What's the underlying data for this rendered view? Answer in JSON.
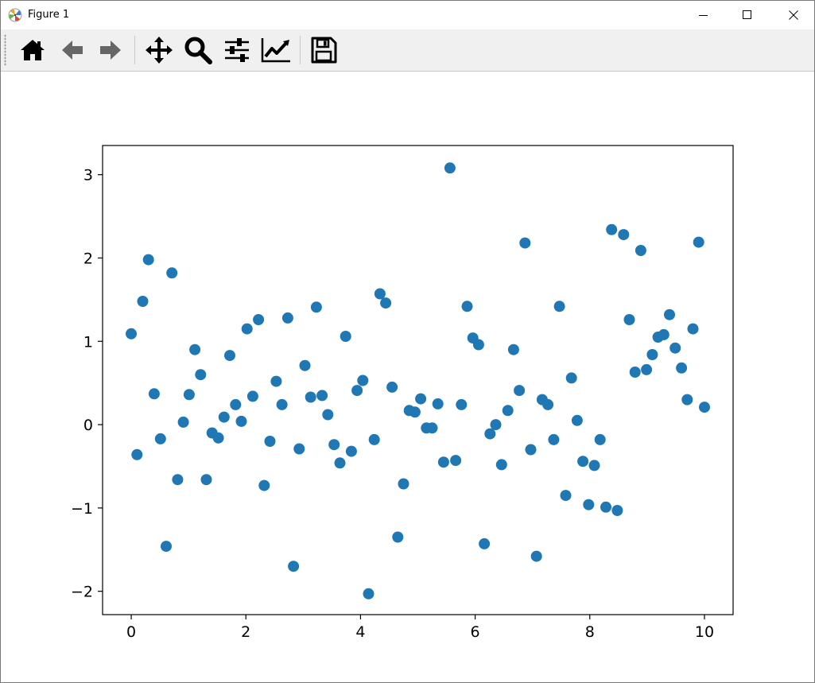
{
  "window": {
    "title": "Figure 1",
    "controls": [
      "minimize",
      "maximize",
      "close"
    ]
  },
  "toolbar": {
    "buttons": [
      {
        "icon": "home-icon",
        "tooltip": "Reset original view"
      },
      {
        "icon": "back-arrow-icon",
        "tooltip": "Back to previous view"
      },
      {
        "icon": "forward-arrow-icon",
        "tooltip": "Forward to next view"
      },
      {
        "icon": "pan-icon",
        "tooltip": "Pan axes"
      },
      {
        "icon": "zoom-icon",
        "tooltip": "Zoom to rectangle"
      },
      {
        "icon": "subplots-icon",
        "tooltip": "Configure subplots"
      },
      {
        "icon": "edit-axis-icon",
        "tooltip": "Edit axis, curve and image parameters"
      },
      {
        "icon": "save-icon",
        "tooltip": "Save the figure"
      }
    ]
  },
  "colors": {
    "marker": "#1f77b4",
    "toolbar_bg": "#f0f0f0",
    "disabled_arrow": "#666666"
  },
  "chart_data": {
    "type": "scatter",
    "title": "",
    "xlabel": "",
    "ylabel": "",
    "xlim": [
      -0.5,
      10.5
    ],
    "ylim": [
      -2.28,
      3.35
    ],
    "xticks": [
      "0",
      "2",
      "4",
      "6",
      "8",
      "10"
    ],
    "xtick_values": [
      0,
      2,
      4,
      6,
      8,
      10
    ],
    "yticks": [
      "−2",
      "−1",
      "0",
      "1",
      "2",
      "3"
    ],
    "ytick_values": [
      -2,
      -1,
      0,
      1,
      2,
      3
    ],
    "grid": false,
    "legend": false,
    "series": [
      {
        "x": [
          0.0,
          0.1,
          0.2,
          0.3,
          0.4,
          0.51,
          0.61,
          0.71,
          0.81,
          0.91,
          1.01,
          1.11,
          1.21,
          1.31,
          1.41,
          1.52,
          1.62,
          1.72,
          1.82,
          1.92,
          2.02,
          2.12,
          2.22,
          2.32,
          2.42,
          2.53,
          2.63,
          2.73,
          2.83,
          2.93,
          3.03,
          3.13,
          3.23,
          3.33,
          3.43,
          3.54,
          3.64,
          3.74,
          3.84,
          3.94,
          4.04,
          4.14,
          4.24,
          4.34,
          4.44,
          4.55,
          4.65,
          4.75,
          4.85,
          4.95,
          5.05,
          5.15,
          5.25,
          5.35,
          5.45,
          5.56,
          5.66,
          5.76,
          5.86,
          5.96,
          6.06,
          6.16,
          6.26,
          6.36,
          6.46,
          6.57,
          6.67,
          6.77,
          6.87,
          6.97,
          7.07,
          7.17,
          7.27,
          7.37,
          7.47,
          7.58,
          7.68,
          7.78,
          7.88,
          7.98,
          8.08,
          8.18,
          8.28,
          8.38,
          8.48,
          8.59,
          8.69,
          8.79,
          8.89,
          8.99,
          9.09,
          9.19,
          9.29,
          9.39,
          9.49,
          9.6,
          9.7,
          9.8,
          9.9,
          10.0
        ],
        "y": [
          1.09,
          -0.36,
          1.48,
          1.98,
          0.37,
          -0.17,
          -1.46,
          1.82,
          -0.66,
          0.03,
          0.36,
          0.9,
          0.6,
          -0.66,
          -0.1,
          -0.16,
          0.09,
          0.83,
          0.24,
          0.04,
          1.15,
          0.34,
          1.26,
          -0.73,
          -0.2,
          0.52,
          0.24,
          1.28,
          -1.7,
          -0.29,
          0.71,
          0.33,
          1.41,
          0.35,
          0.12,
          -0.24,
          -0.46,
          1.06,
          -0.32,
          0.41,
          0.53,
          -2.03,
          -0.18,
          1.57,
          1.46,
          0.45,
          -1.35,
          -0.71,
          0.17,
          0.15,
          0.31,
          -0.04,
          -0.04,
          0.25,
          -0.45,
          3.08,
          -0.43,
          0.24,
          1.42,
          1.04,
          0.96,
          -1.43,
          -0.11,
          0.0,
          -0.48,
          0.17,
          0.9,
          0.41,
          2.18,
          -0.3,
          -1.58,
          0.3,
          0.24,
          -0.18,
          1.42,
          -0.85,
          0.56,
          0.05,
          -0.44,
          -0.96,
          -0.49,
          -0.18,
          -0.99,
          2.34,
          -1.03,
          2.28,
          1.26,
          0.63,
          2.09,
          0.66,
          0.84,
          1.05,
          1.08,
          1.32,
          0.92,
          0.68,
          0.3,
          1.15,
          2.19,
          0.21
        ]
      }
    ]
  }
}
